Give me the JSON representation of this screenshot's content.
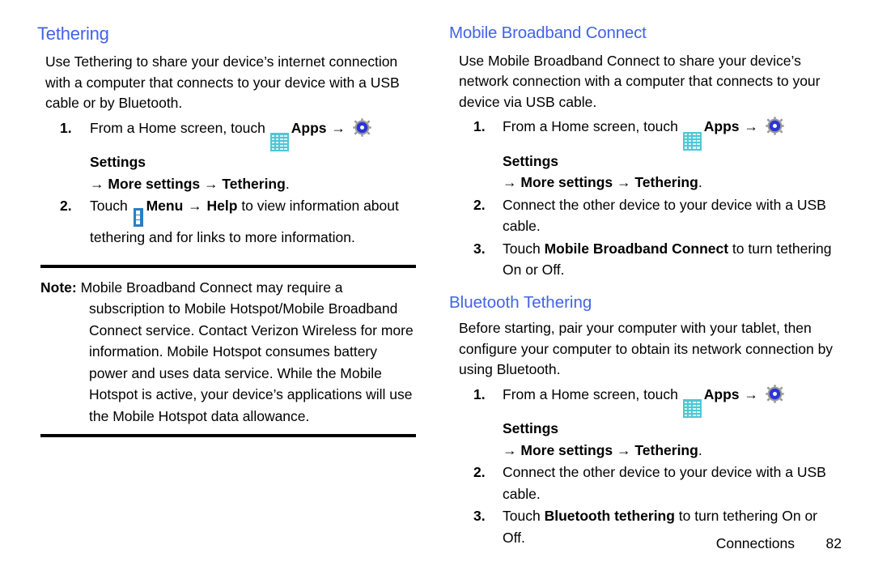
{
  "left_column": {
    "heading": "Tethering",
    "intro": "Use Tethering to share your device’s internet connection with a computer that connects to your device with a USB cable or by Bluetooth.",
    "steps": [
      {
        "num": "1.",
        "text_before_apps": "From a Home screen, touch ",
        "apps_label": "Apps",
        "arrow": "→",
        "settings_label": "Settings",
        "sub_line_prefix": "→ ",
        "sub_line_1": "More settings",
        "sub_line_mid": " → ",
        "sub_line_2": "Tethering",
        "sub_line_end": "."
      },
      {
        "num": "2.",
        "text_start": "Touch ",
        "menu_label": "Menu",
        "arrow": "→",
        "help_label": "Help",
        "text_end": " to view information about tethering and for links to more information."
      }
    ],
    "note": {
      "label": "Note:",
      "body": " Mobile Broadband Connect may require a subscription to Mobile Hotspot/Mobile Broadband Connect service. Contact Verizon Wireless for more information. Mobile Hotspot consumes battery power and uses data service. While the Mobile Hotspot is active, your device’s applications will use the Mobile Hotspot data allowance."
    }
  },
  "right_column": {
    "heading": "Mobile Broadband Connect",
    "intro": "Use Mobile Broadband Connect to share your device’s network connection with a computer that connects to your device via USB cable.",
    "steps": [
      {
        "num": "1.",
        "text_before_apps": "From a Home screen, touch ",
        "apps_label": "Apps",
        "arrow": "→",
        "settings_label": "Settings",
        "sub_line_prefix": "→ ",
        "sub_line_1": "More settings",
        "sub_line_mid": " → ",
        "sub_line_2": "Tethering",
        "sub_line_end": "."
      },
      {
        "num": "2.",
        "text": "Connect the other device to your device with a USB cable."
      },
      {
        "num": "3.",
        "text_start": "Touch ",
        "bold": "Mobile Broadband Connect",
        "text_end": " to turn tethering On or Off."
      }
    ],
    "sub_section": {
      "heading": "Bluetooth Tethering",
      "intro": "Before starting, pair your computer with your tablet, then configure your computer to obtain its network connection by using Bluetooth.",
      "steps": [
        {
          "num": "1.",
          "text_before_apps": "From a Home screen, touch ",
          "apps_label": "Apps",
          "arrow": "→",
          "settings_label": "Settings",
          "sub_line_prefix": "→ ",
          "sub_line_1": "More settings",
          "sub_line_mid": " → ",
          "sub_line_2": "Tethering",
          "sub_line_end": "."
        },
        {
          "num": "2.",
          "text": "Connect the other device to your device with a USB cable."
        },
        {
          "num": "3.",
          "text_start": "Touch ",
          "bold": "Bluetooth tethering",
          "text_end": " to turn tethering On or Off."
        }
      ]
    }
  },
  "footer": {
    "chapter": "Connections",
    "page_number": "82"
  },
  "icons": {
    "apps": "apps-grid-icon",
    "settings": "gear-icon",
    "menu": "menu-dots-icon"
  },
  "colors": {
    "heading": "#4263e8",
    "apps_icon": "#4ec7d4",
    "gear_ring": "#2b35d6",
    "gear_body": "#9a9a9a",
    "menu_icon": "#2a7fc4",
    "rule": "#000000"
  }
}
